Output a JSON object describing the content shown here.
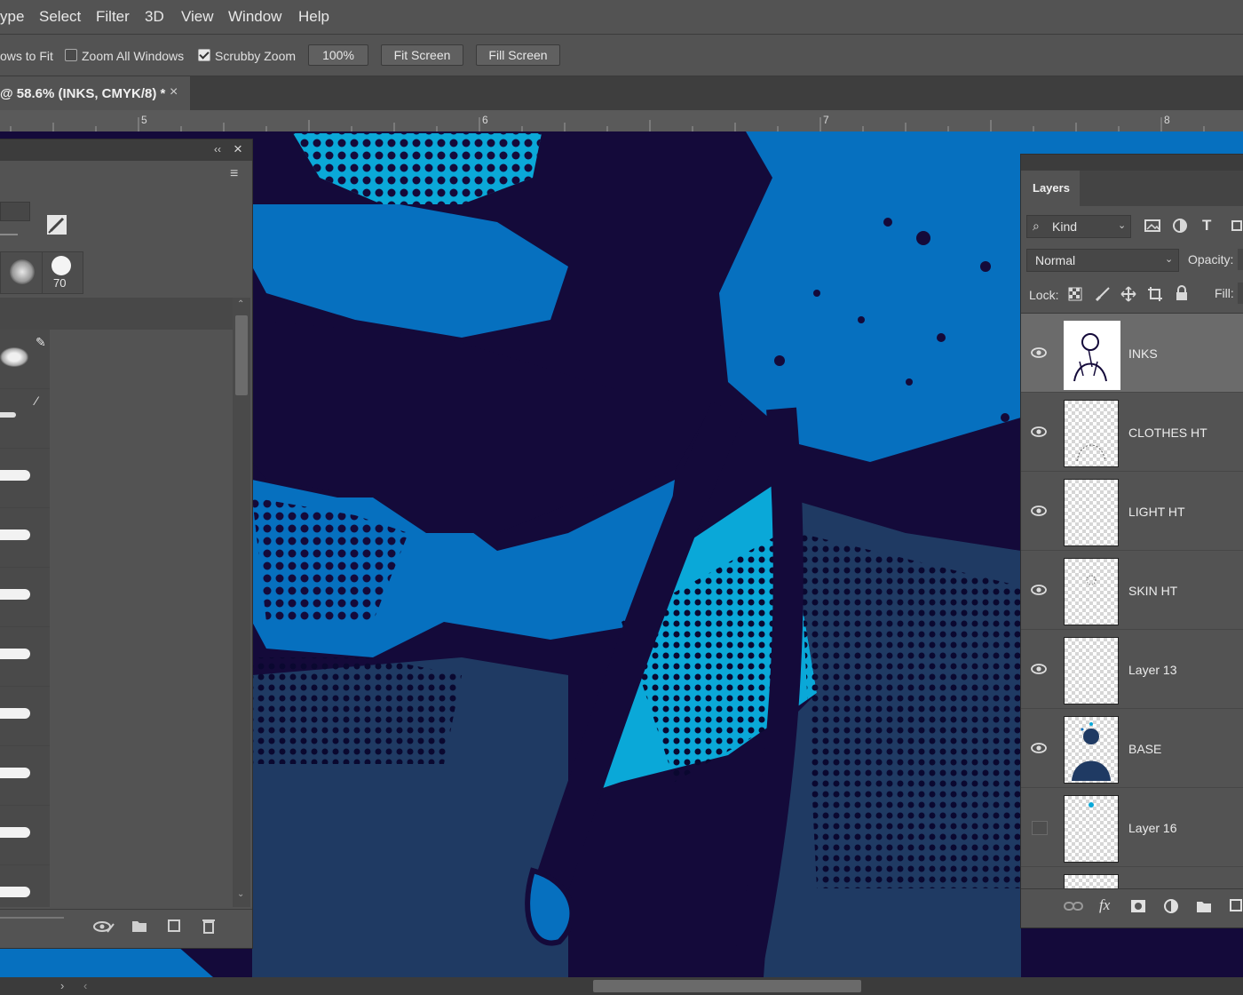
{
  "menu": {
    "items": [
      "ype",
      "Select",
      "Filter",
      "3D",
      "View",
      "Window",
      "Help"
    ]
  },
  "options": {
    "resize_windows": "ows to Fit",
    "zoom_all_windows": "Zoom All Windows",
    "scrubby_zoom": "Scrubby Zoom",
    "zoom_value": "100%",
    "fit_screen": "Fit Screen",
    "fill_screen": "Fill Screen"
  },
  "document_tab": {
    "label": "@ 58.6% (INKS, CMYK/8) *",
    "close": "×"
  },
  "ruler": {
    "marks": [
      "5",
      "6",
      "7",
      "8"
    ]
  },
  "brush_panel": {
    "collapse": "‹‹",
    "close": "×",
    "menu": "≡",
    "brush_size": "70"
  },
  "layers_panel": {
    "tab_label": "Layers",
    "filter_kind": "Kind",
    "blend_mode": "Normal",
    "opacity_label": "Opacity:",
    "lock_label": "Lock:",
    "fill_label": "Fill:",
    "layers": [
      {
        "name": "INKS",
        "visible": true,
        "selected": true
      },
      {
        "name": "CLOTHES HT",
        "visible": true,
        "selected": false
      },
      {
        "name": "LIGHT HT",
        "visible": true,
        "selected": false
      },
      {
        "name": "SKIN HT",
        "visible": true,
        "selected": false
      },
      {
        "name": "Layer 13",
        "visible": true,
        "selected": false
      },
      {
        "name": "BASE",
        "visible": true,
        "selected": false
      },
      {
        "name": "Layer 16",
        "visible": false,
        "selected": false
      }
    ],
    "footer_fx": "fx"
  },
  "colors": {
    "ink": "#140a3a",
    "blue": "#0670bf",
    "cyan": "#0aa8d8",
    "navy": "#1f3a63"
  }
}
